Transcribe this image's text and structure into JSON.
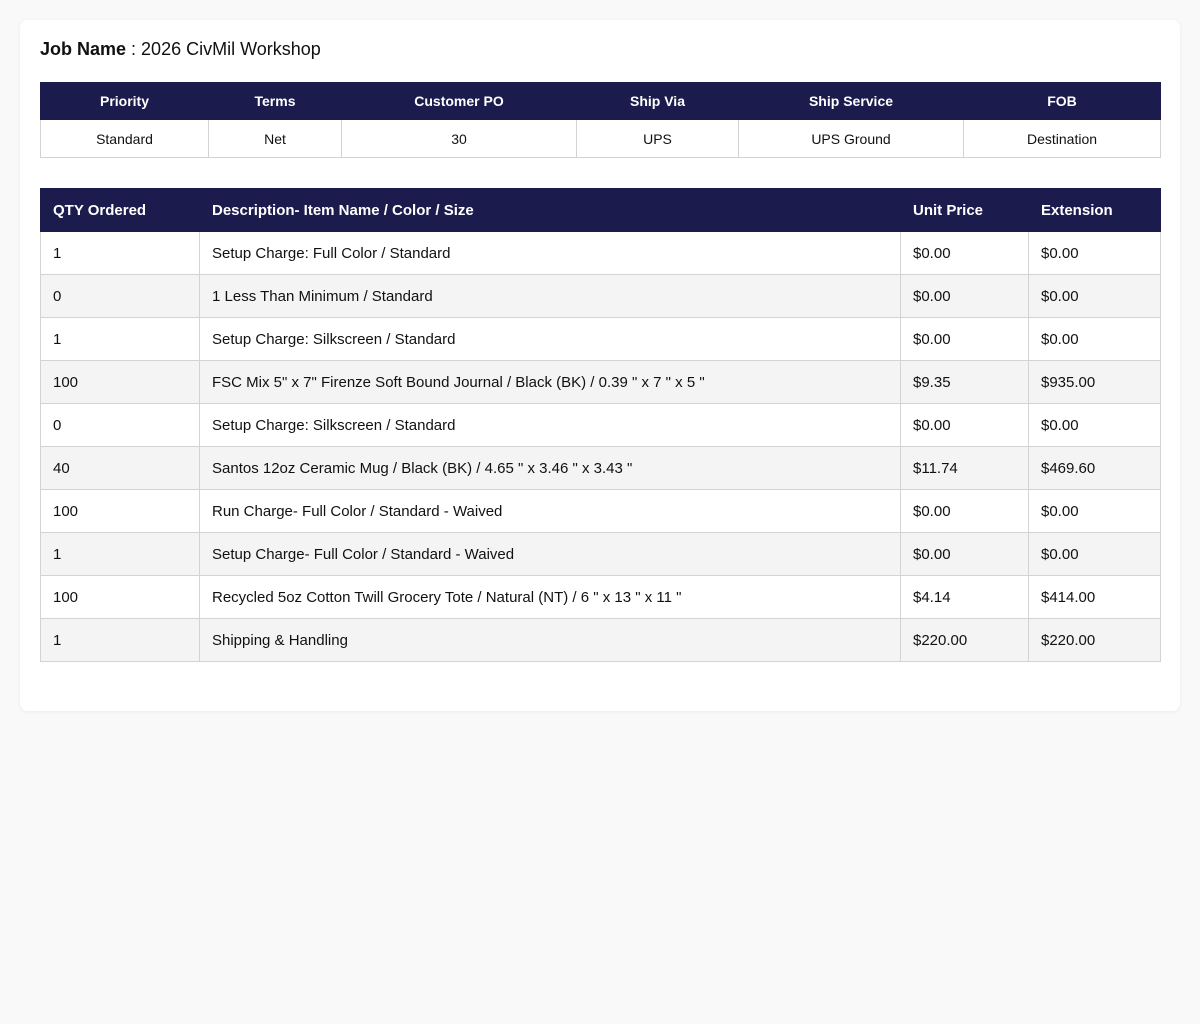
{
  "job": {
    "label": "Job Name",
    "separator": " : ",
    "value": "2026 CivMil Workshop"
  },
  "info_table": {
    "headers": [
      "Priority",
      "Terms",
      "Customer PO",
      "Ship Via",
      "Ship Service",
      "FOB"
    ],
    "values": [
      "Standard",
      "Net",
      "30",
      "UPS",
      "UPS Ground",
      "Destination"
    ]
  },
  "items_table": {
    "headers": [
      "QTY Ordered",
      "Description- Item Name / Color / Size",
      "Unit Price",
      "Extension"
    ],
    "rows": [
      {
        "qty": "1",
        "description": "Setup Charge: Full Color / Standard",
        "unit_price": "$0.00",
        "extension": "$0.00"
      },
      {
        "qty": "0",
        "description": "1 Less Than Minimum / Standard",
        "unit_price": "$0.00",
        "extension": "$0.00"
      },
      {
        "qty": "1",
        "description": "Setup Charge: Silkscreen / Standard",
        "unit_price": "$0.00",
        "extension": "$0.00"
      },
      {
        "qty": "100",
        "description": "FSC Mix 5\" x 7\" Firenze Soft Bound Journal / Black (BK) / 0.39 \" x 7 \" x 5 \"",
        "unit_price": "$9.35",
        "extension": "$935.00"
      },
      {
        "qty": "0",
        "description": "Setup Charge: Silkscreen / Standard",
        "unit_price": "$0.00",
        "extension": "$0.00"
      },
      {
        "qty": "40",
        "description": "Santos 12oz Ceramic Mug / Black (BK) / 4.65 \" x 3.46 \" x 3.43 \"",
        "unit_price": "$11.74",
        "extension": "$469.60"
      },
      {
        "qty": "100",
        "description": "Run Charge- Full Color / Standard - Waived",
        "unit_price": "$0.00",
        "extension": "$0.00"
      },
      {
        "qty": "1",
        "description": "Setup Charge- Full Color / Standard - Waived",
        "unit_price": "$0.00",
        "extension": "$0.00"
      },
      {
        "qty": "100",
        "description": "Recycled 5oz Cotton Twill Grocery Tote / Natural (NT) / 6 \" x 13 \" x 11 \"",
        "unit_price": "$4.14",
        "extension": "$414.00"
      },
      {
        "qty": "1",
        "description": "Shipping & Handling",
        "unit_price": "$220.00",
        "extension": "$220.00"
      }
    ]
  },
  "colors": {
    "header_bg": "#1b1b4d",
    "alt_row_bg": "#f4f4f4"
  }
}
